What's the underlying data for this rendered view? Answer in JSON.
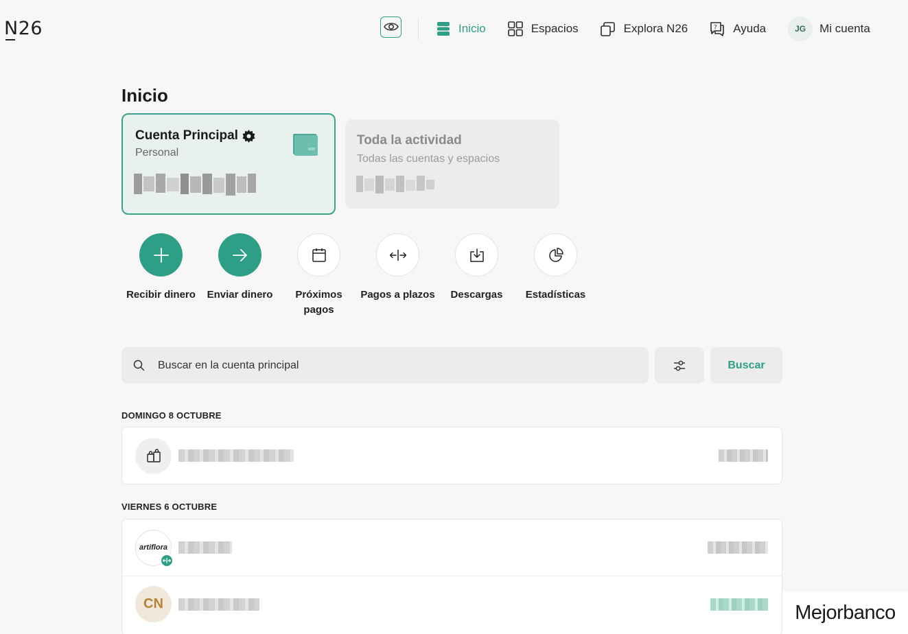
{
  "brand": {
    "logo": "N26"
  },
  "nav": {
    "privacy_icon": "eye-icon",
    "items": [
      {
        "label": "Inicio",
        "icon": "home-icon",
        "active": true
      },
      {
        "label": "Espacios",
        "icon": "grid-icon",
        "active": false
      },
      {
        "label": "Explora N26",
        "icon": "cards-stack-icon",
        "active": false
      },
      {
        "label": "Ayuda",
        "icon": "help-icon",
        "active": false
      }
    ],
    "account": {
      "initials": "JG",
      "label": "Mi cuenta"
    }
  },
  "page": {
    "title": "Inicio"
  },
  "accounts": {
    "main": {
      "title": "Cuenta Principal",
      "subtitle": "Personal",
      "balance_hidden": true
    },
    "all": {
      "title": "Toda la actividad",
      "subtitle": "Todas las cuentas y espacios",
      "balance_hidden": true
    }
  },
  "actions": [
    {
      "label": "Recibir dinero",
      "icon": "plus-icon",
      "style": "primary"
    },
    {
      "label": "Enviar dinero",
      "icon": "arrow-right-icon",
      "style": "primary"
    },
    {
      "label": "Próximos pagos",
      "icon": "calendar-icon",
      "style": "secondary"
    },
    {
      "label": "Pagos a plazos",
      "icon": "split-arrows-icon",
      "style": "secondary"
    },
    {
      "label": "Descargas",
      "icon": "download-icon",
      "style": "secondary"
    },
    {
      "label": "Estadísticas",
      "icon": "pie-chart-icon",
      "style": "secondary"
    }
  ],
  "search": {
    "placeholder": "Buscar en la cuenta principal",
    "filter_icon": "sliders-icon",
    "button_label": "Buscar"
  },
  "transactions": [
    {
      "date": "DOMINGO 8 OCTUBRE",
      "items": [
        {
          "avatar": "shopping-bags-icon",
          "blurred": true
        }
      ]
    },
    {
      "date": "VIERNES 6 OCTUBRE",
      "items": [
        {
          "avatar_text": "artiflora",
          "badge": "split-arrows-icon",
          "blurred": true
        },
        {
          "avatar_text": "CN",
          "blurred": true,
          "amount_color": "green"
        }
      ]
    }
  ],
  "watermark": "Mejorbanco",
  "colors": {
    "accent": "#2e9e87",
    "background": "#f7f7f7",
    "card_active": "#e8f1ee"
  }
}
